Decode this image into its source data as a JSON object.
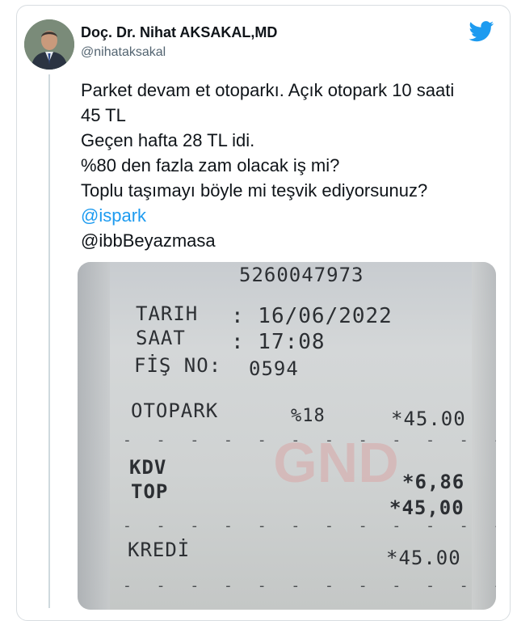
{
  "author": {
    "name": "Doç. Dr. Nihat AKSAKAL,MD",
    "handle": "@nihataksakal"
  },
  "icons": {
    "avatar": "profile-photo",
    "brand": "twitter-bird-icon"
  },
  "colors": {
    "brand": "#1d9bf0",
    "link": "#1d9bf0",
    "text": "#0f1419",
    "muted": "#536471"
  },
  "tweet": {
    "lines": [
      "Parket devam et otoparkı. Açık otopark 10 saati",
      "45 TL",
      "Geçen hafta 28 TL idi.",
      "%80 den fazla zam olacak iş mi?",
      "Toplu taşımayı böyle mi teşvik ediyorsunuz?"
    ],
    "mention_link": "@ispark",
    "mention_plain": "@ibbBeyazmasa"
  },
  "receipt": {
    "number": "5260047973",
    "date_label": "TARIH",
    "date_value": ": 16/06/2022",
    "time_label": "SAAT",
    "time_value": ": 17:08",
    "fis_label": "FİŞ NO:",
    "fis_value": "0594",
    "item": "OTOPARK",
    "vat_rate": "%18",
    "item_total": "*45.00",
    "kdv_label": "KDV",
    "kdv_value": "*6,86",
    "top_label": "TOP",
    "top_value": "*45,00",
    "kredi_label": "KREDİ",
    "kredi_value": "*45.00",
    "watermark": "GND"
  }
}
